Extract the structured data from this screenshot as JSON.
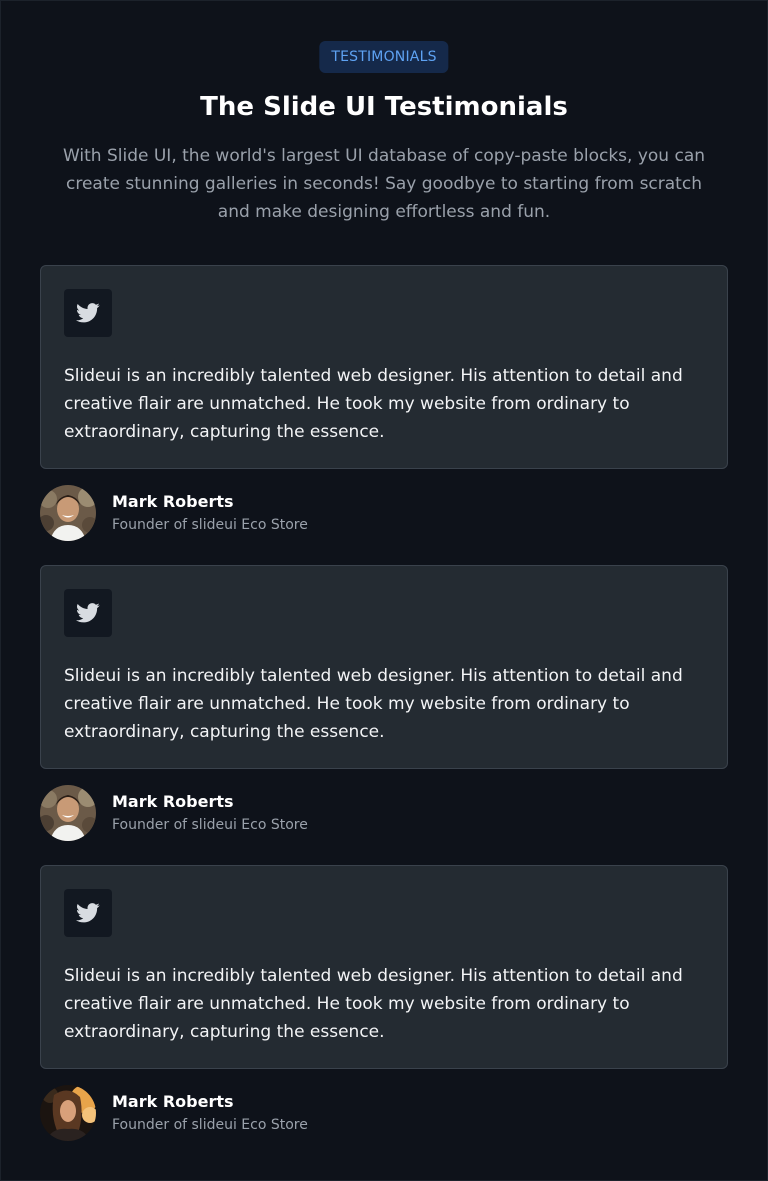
{
  "header": {
    "badge": "TESTIMONIALS",
    "title": "The Slide UI Testimonials",
    "subtitle": "With Slide UI, the world's largest UI database of copy-paste blocks, you can create stunning galleries in seconds! Say goodbye to starting from scratch and make designing effortless and fun."
  },
  "testimonials": [
    {
      "icon": "twitter-icon",
      "quote": "Slideui is an incredibly talented web designer. His attention to detail and creative flair are unmatched. He took my website from ordinary to extraordinary, capturing the essence.",
      "name": "Mark Roberts",
      "role": "Founder of slideui Eco Store"
    },
    {
      "icon": "twitter-icon",
      "quote": "Slideui is an incredibly talented web designer. His attention to detail and creative flair are unmatched. He took my website from ordinary to extraordinary, capturing the essence.",
      "name": "Mark Roberts",
      "role": "Founder of slideui Eco Store"
    },
    {
      "icon": "twitter-icon",
      "quote": "Slideui is an incredibly talented web designer. His attention to detail and creative flair are unmatched. He took my website from ordinary to extraordinary, capturing the essence.",
      "name": "Mark Roberts",
      "role": "Founder of slideui Eco Store"
    }
  ],
  "colors": {
    "background": "#0e121a",
    "card": "#242b32",
    "badge_bg": "#15294a",
    "badge_text": "#5ea2f2",
    "muted_text": "#9aa1ab"
  }
}
